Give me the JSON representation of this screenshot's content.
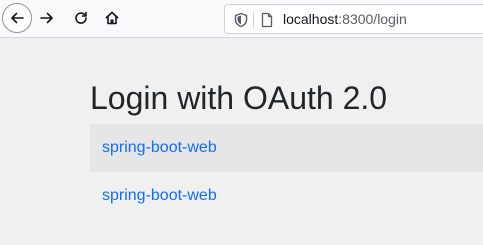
{
  "browser": {
    "url_host": "localhost",
    "url_rest": ":8300/login"
  },
  "page": {
    "title": "Login with OAuth 2.0",
    "clients": [
      {
        "label": "spring-boot-web"
      },
      {
        "label": "spring-boot-web"
      }
    ]
  }
}
